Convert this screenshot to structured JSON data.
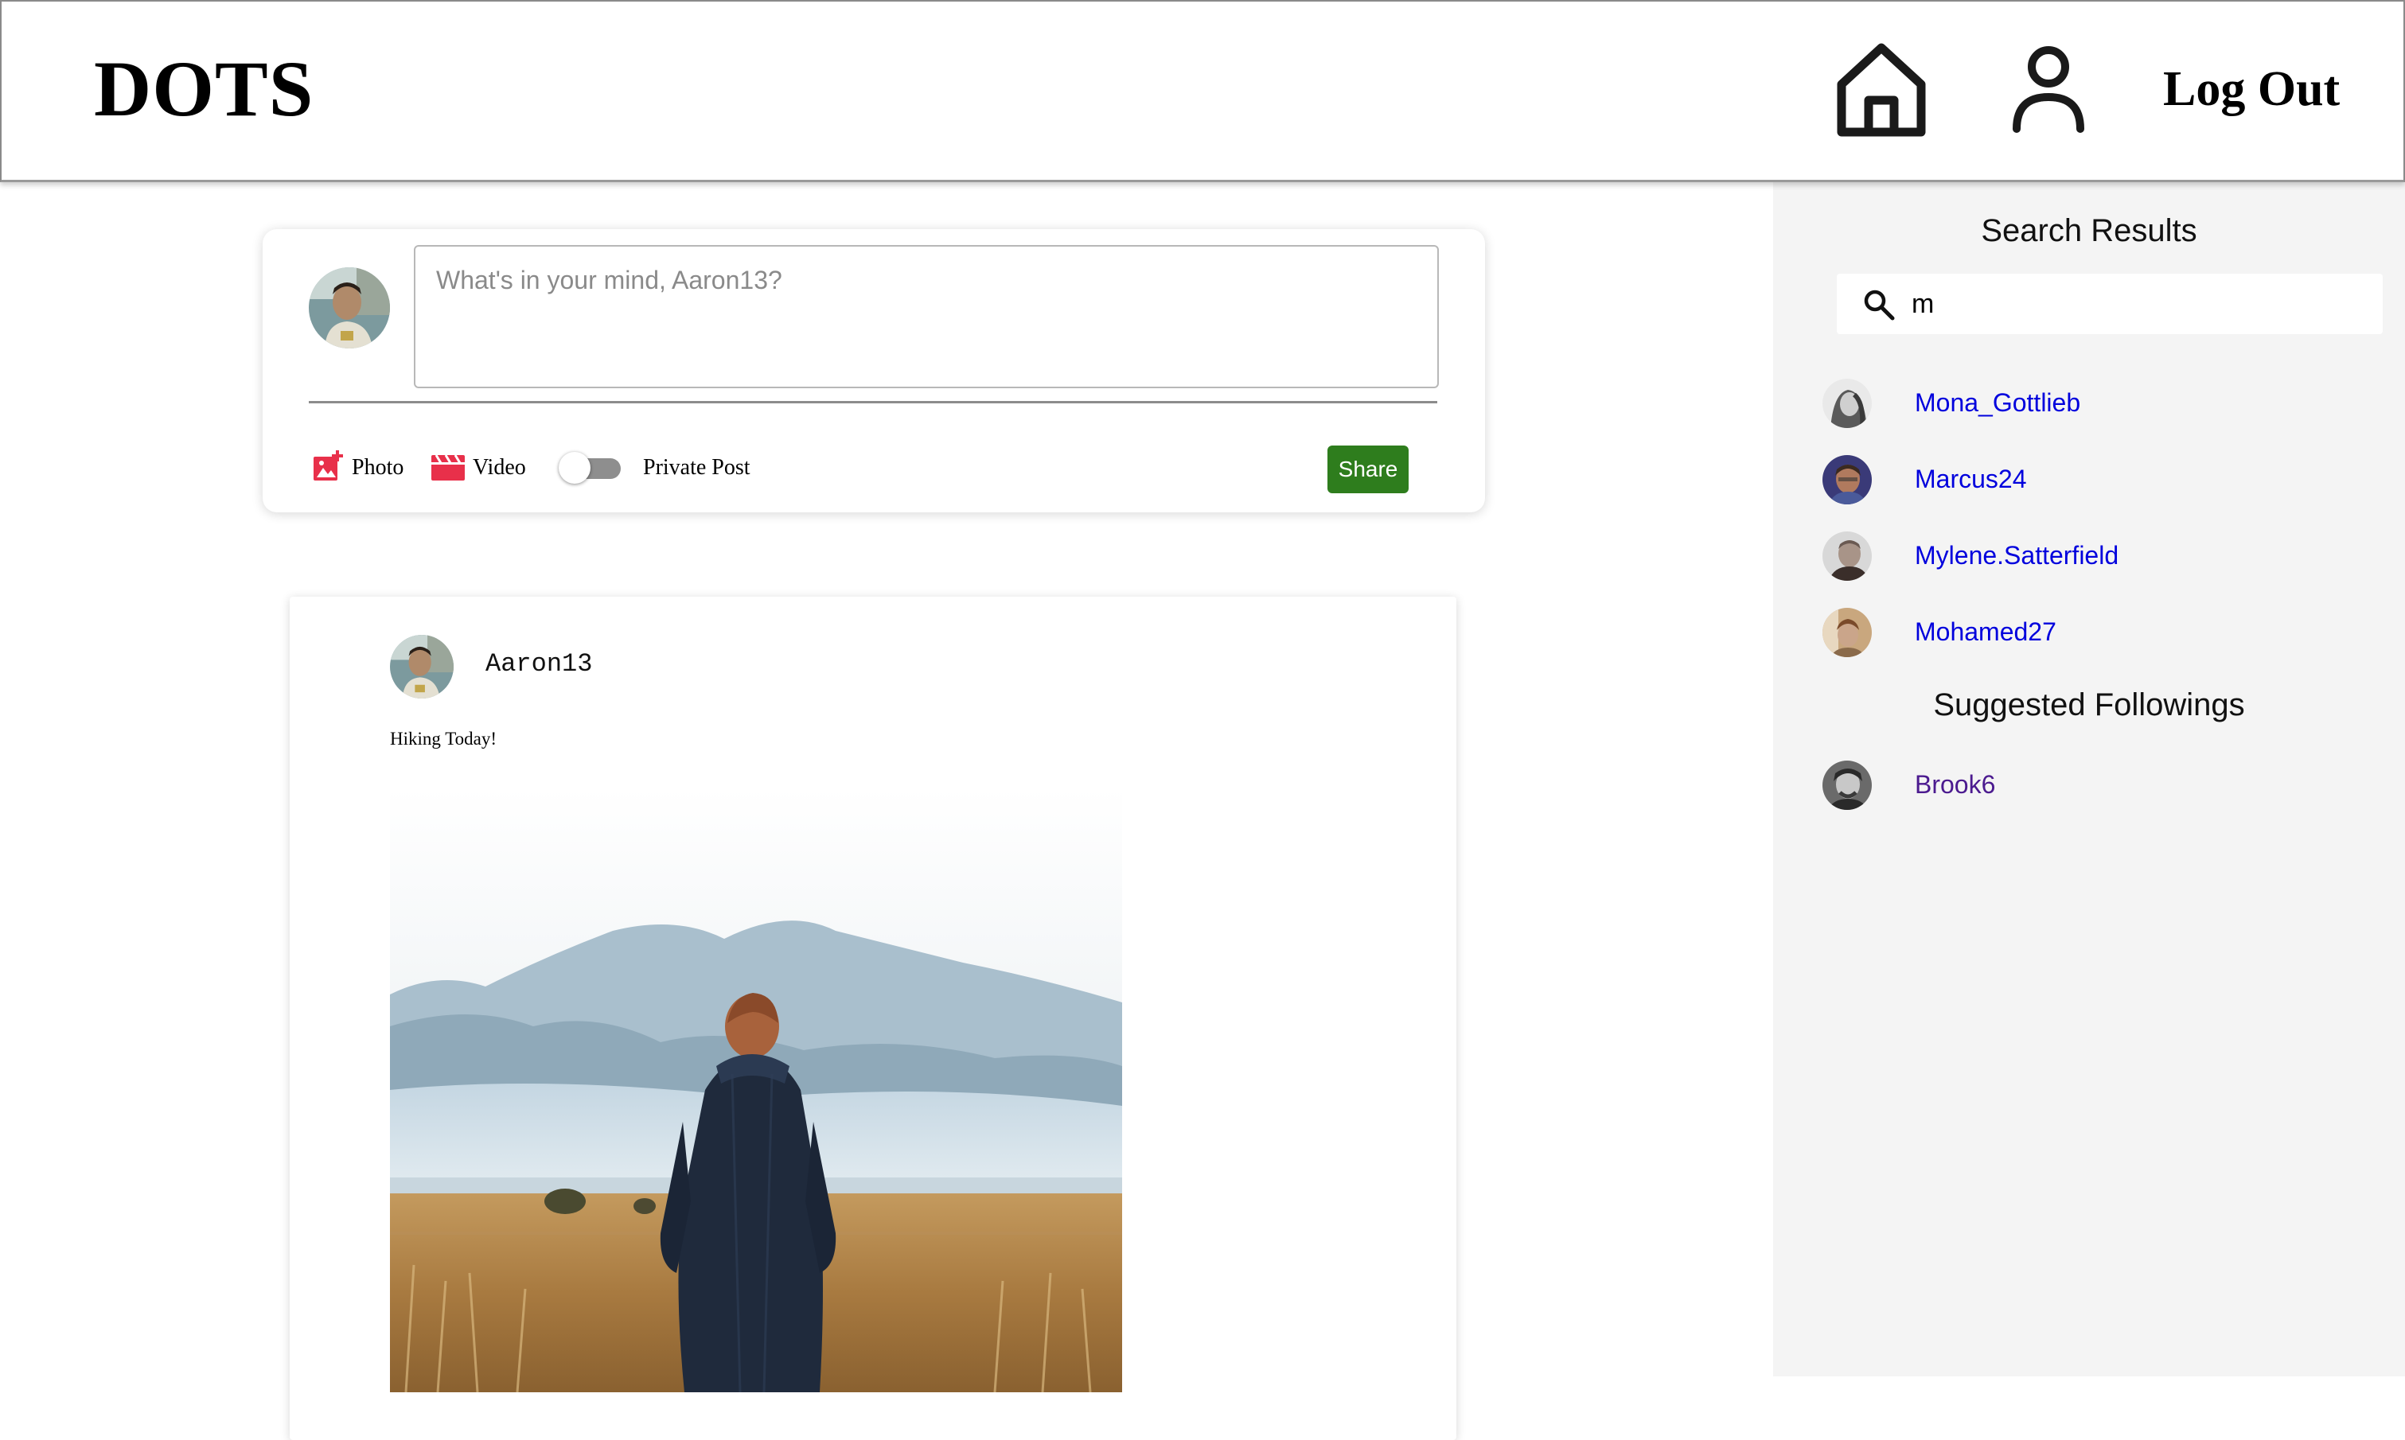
{
  "header": {
    "logo": "DOTS",
    "home_icon": "home-icon",
    "profile_icon": "user-icon",
    "logout_label": "Log Out"
  },
  "composer": {
    "placeholder": "What's in your mind, Aaron13?",
    "photo_label": "Photo",
    "video_label": "Video",
    "private_label": "Private Post",
    "private_enabled": false,
    "share_label": "Share",
    "colors": {
      "share": "#2e7d1d",
      "media_icons": "#e8304a"
    }
  },
  "post": {
    "author": "Aaron13",
    "text": "Hiking Today!"
  },
  "sidebar": {
    "search_title": "Search Results",
    "search_value": "m",
    "results": [
      {
        "name": "Mona_Gottlieb"
      },
      {
        "name": "Marcus24"
      },
      {
        "name": "Mylene.Satterfield"
      },
      {
        "name": "Mohamed27"
      }
    ],
    "suggested_title": "Suggested Followings",
    "suggested": [
      {
        "name": "Brook6"
      }
    ],
    "colors": {
      "link": "#0000dd",
      "visited_link": "#4b1a8f"
    }
  }
}
